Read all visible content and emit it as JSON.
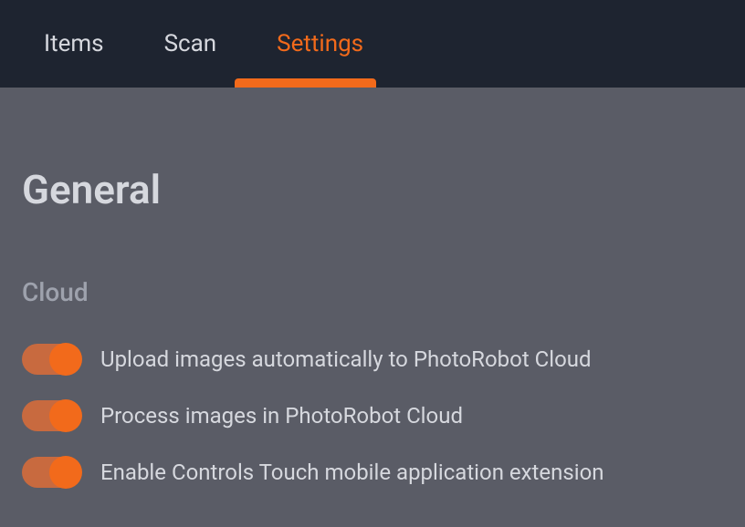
{
  "tabs": {
    "items": "Items",
    "scan": "Scan",
    "settings": "Settings",
    "active": "settings"
  },
  "page": {
    "title": "General"
  },
  "section": {
    "cloud": {
      "title": "Cloud",
      "toggles": [
        {
          "label": "Upload images automatically to PhotoRobot Cloud",
          "on": true
        },
        {
          "label": "Process images in PhotoRobot Cloud",
          "on": true
        },
        {
          "label": "Enable Controls Touch mobile application extension",
          "on": true
        }
      ]
    }
  },
  "colors": {
    "accent": "#f26a1b",
    "tabBarBg": "#1e2430",
    "contentBg": "#5a5c66",
    "textPrimary": "#d6d8de",
    "textSecondary": "#9ea2ad"
  }
}
